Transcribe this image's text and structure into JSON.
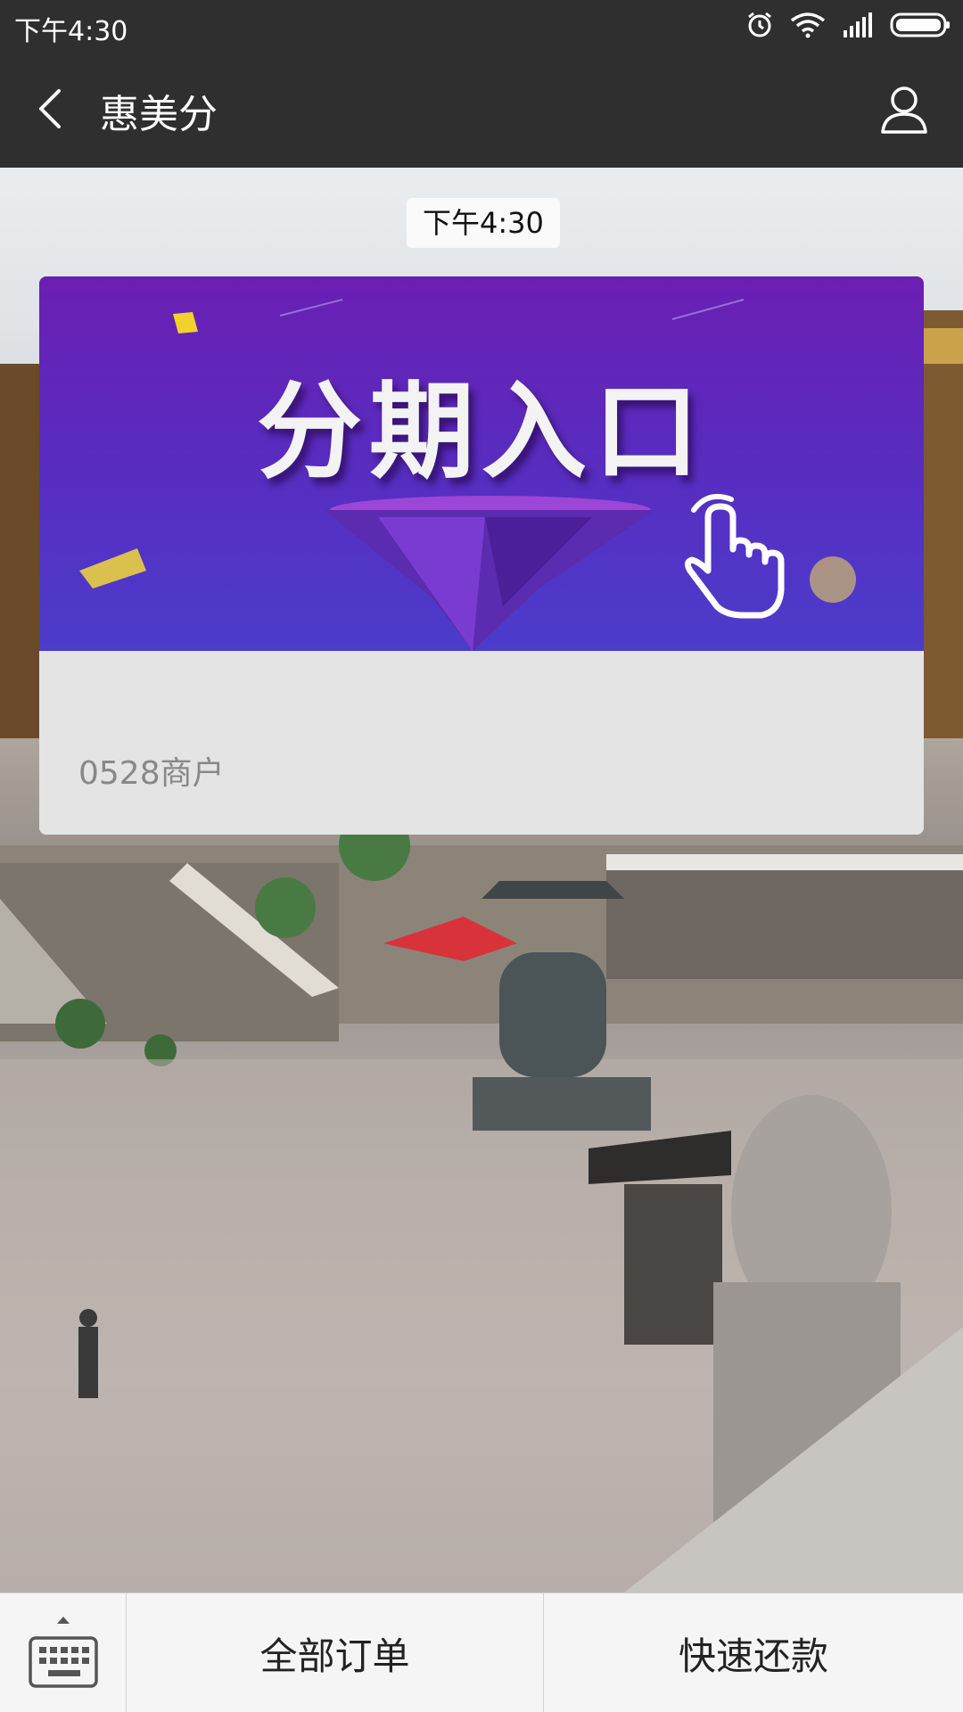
{
  "status_bar": {
    "time": "下午4:30",
    "icons": [
      "alarm-icon",
      "wifi-icon",
      "signal-icon",
      "battery-icon"
    ]
  },
  "header": {
    "title": "惠美分",
    "back_icon": "chevron-left-icon",
    "profile_icon": "person-icon"
  },
  "chat": {
    "timestamp": "下午4:30",
    "card": {
      "banner_text": "分期入口",
      "merchant": "0528商户"
    }
  },
  "bottom_menu": {
    "keyboard_icon": "keyboard-icon",
    "items": [
      {
        "label": "全部订单"
      },
      {
        "label": "快速还款"
      }
    ]
  },
  "colors": {
    "bar_dark": "#2f2f2f",
    "banner_purple": "#5a2bbf",
    "card_footer": "#e4e4e4",
    "bottom_bar": "#f5f5f5"
  }
}
